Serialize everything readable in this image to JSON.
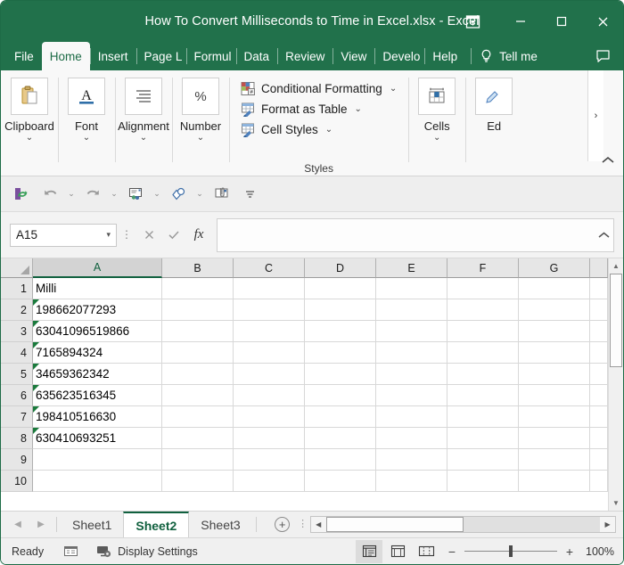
{
  "window": {
    "title": "How To Convert Milliseconds to Time in Excel.xlsx",
    "separator": "-",
    "app_name": "Excel",
    "ribbon_display_options": "ribbon-display-options",
    "minimize": "minimize",
    "maximize": "maximize",
    "close": "close",
    "accent_color": "#21714b"
  },
  "tabs": [
    {
      "label": "File",
      "active": false
    },
    {
      "label": "Home",
      "active": true
    },
    {
      "label": "Insert",
      "active": false
    },
    {
      "label": "Page L",
      "active": false
    },
    {
      "label": "Formul",
      "active": false
    },
    {
      "label": "Data",
      "active": false
    },
    {
      "label": "Review",
      "active": false
    },
    {
      "label": "View",
      "active": false
    },
    {
      "label": "Develo",
      "active": false
    },
    {
      "label": "Help",
      "active": false
    }
  ],
  "tell_me": {
    "label": "Tell me",
    "icon": "lightbulb-icon"
  },
  "comments": {
    "icon": "comment-icon"
  },
  "ribbon": {
    "groups": [
      {
        "label": "Clipboard",
        "icon": "clipboard-icon",
        "has_dropdown": true
      },
      {
        "label": "Font",
        "icon": "font-a-icon",
        "has_dropdown": true
      },
      {
        "label": "Alignment",
        "icon": "alignment-icon",
        "has_dropdown": true
      },
      {
        "label": "Number",
        "icon": "percent-icon",
        "has_dropdown": true
      }
    ],
    "styles": {
      "title": "Styles",
      "items": [
        {
          "label": "Conditional Formatting",
          "icon": "conditional-formatting-icon"
        },
        {
          "label": "Format as Table",
          "icon": "format-as-table-icon"
        },
        {
          "label": "Cell Styles",
          "icon": "cell-styles-icon"
        }
      ]
    },
    "cells": {
      "label": "Cells",
      "icon": "cells-icon",
      "has_dropdown": true
    },
    "editing": {
      "label": "Ed",
      "icon": "editing-icon"
    },
    "overflow": "more-commands",
    "collapse": "collapse-ribbon"
  },
  "quick_access": {
    "buttons": [
      {
        "name": "autosave-sync-icon",
        "glyph": "↻"
      },
      {
        "name": "undo-icon",
        "glyph": "↶"
      },
      {
        "name": "redo-icon",
        "glyph": "↷"
      },
      {
        "name": "email-recipients-icon",
        "glyph": "✉"
      },
      {
        "name": "ink-shapes-icon",
        "glyph": "◐"
      },
      {
        "name": "attachment-icon",
        "glyph": "📎"
      },
      {
        "name": "more-quick-access-icon",
        "glyph": "≡"
      }
    ]
  },
  "formula_bar": {
    "name_box_value": "A15",
    "cancel": "cancel",
    "enter": "enter",
    "insert_function": "fx",
    "formula_value": "",
    "expand": "expand-formula-bar"
  },
  "grid": {
    "columns": [
      {
        "label": "A",
        "width": 145,
        "selected": true
      },
      {
        "label": "B",
        "width": 80,
        "selected": false
      },
      {
        "label": "C",
        "width": 80,
        "selected": false
      },
      {
        "label": "D",
        "width": 80,
        "selected": false
      },
      {
        "label": "E",
        "width": 80,
        "selected": false
      },
      {
        "label": "F",
        "width": 80,
        "selected": false
      },
      {
        "label": "G",
        "width": 80,
        "selected": false
      },
      {
        "label": "",
        "width": 22,
        "selected": false
      }
    ],
    "rows": [
      {
        "number": "1",
        "value": "Milli",
        "flagged": false
      },
      {
        "number": "2",
        "value": "198662077293",
        "flagged": true
      },
      {
        "number": "3",
        "value": "63041096519866",
        "flagged": true
      },
      {
        "number": "4",
        "value": "7165894324",
        "flagged": true
      },
      {
        "number": "5",
        "value": "34659362342",
        "flagged": true
      },
      {
        "number": "6",
        "value": "635623516345",
        "flagged": true
      },
      {
        "number": "7",
        "value": "198410516630",
        "flagged": true
      },
      {
        "number": "8",
        "value": "630410693251",
        "flagged": true
      },
      {
        "number": "9",
        "value": "",
        "flagged": false
      },
      {
        "number": "10",
        "value": "",
        "flagged": false
      }
    ]
  },
  "sheets": {
    "first": "first-sheet",
    "previous": "previous-sheet",
    "items": [
      {
        "label": "Sheet1",
        "active": false
      },
      {
        "label": "Sheet2",
        "active": true
      },
      {
        "label": "Sheet3",
        "active": false
      }
    ],
    "add": "+"
  },
  "status": {
    "ready": "Ready",
    "accessibility_icon": "accessibility-checker-icon",
    "display_settings": "Display Settings",
    "display_settings_icon": "display-settings-icon",
    "views": [
      {
        "name": "normal-view",
        "active": true
      },
      {
        "name": "page-layout-view",
        "active": false
      },
      {
        "name": "page-break-preview",
        "active": false
      }
    ],
    "zoom_out": "−",
    "zoom_in": "+",
    "zoom_level": "100%"
  }
}
